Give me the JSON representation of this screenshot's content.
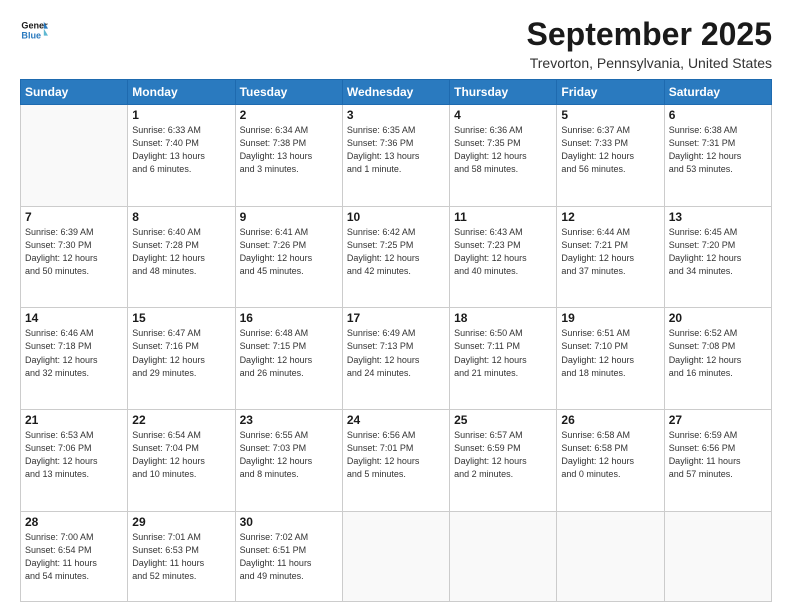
{
  "header": {
    "logo_general": "General",
    "logo_blue": "Blue",
    "month": "September 2025",
    "location": "Trevorton, Pennsylvania, United States"
  },
  "weekdays": [
    "Sunday",
    "Monday",
    "Tuesday",
    "Wednesday",
    "Thursday",
    "Friday",
    "Saturday"
  ],
  "weeks": [
    [
      {
        "day": "",
        "info": ""
      },
      {
        "day": "1",
        "info": "Sunrise: 6:33 AM\nSunset: 7:40 PM\nDaylight: 13 hours\nand 6 minutes."
      },
      {
        "day": "2",
        "info": "Sunrise: 6:34 AM\nSunset: 7:38 PM\nDaylight: 13 hours\nand 3 minutes."
      },
      {
        "day": "3",
        "info": "Sunrise: 6:35 AM\nSunset: 7:36 PM\nDaylight: 13 hours\nand 1 minute."
      },
      {
        "day": "4",
        "info": "Sunrise: 6:36 AM\nSunset: 7:35 PM\nDaylight: 12 hours\nand 58 minutes."
      },
      {
        "day": "5",
        "info": "Sunrise: 6:37 AM\nSunset: 7:33 PM\nDaylight: 12 hours\nand 56 minutes."
      },
      {
        "day": "6",
        "info": "Sunrise: 6:38 AM\nSunset: 7:31 PM\nDaylight: 12 hours\nand 53 minutes."
      }
    ],
    [
      {
        "day": "7",
        "info": "Sunrise: 6:39 AM\nSunset: 7:30 PM\nDaylight: 12 hours\nand 50 minutes."
      },
      {
        "day": "8",
        "info": "Sunrise: 6:40 AM\nSunset: 7:28 PM\nDaylight: 12 hours\nand 48 minutes."
      },
      {
        "day": "9",
        "info": "Sunrise: 6:41 AM\nSunset: 7:26 PM\nDaylight: 12 hours\nand 45 minutes."
      },
      {
        "day": "10",
        "info": "Sunrise: 6:42 AM\nSunset: 7:25 PM\nDaylight: 12 hours\nand 42 minutes."
      },
      {
        "day": "11",
        "info": "Sunrise: 6:43 AM\nSunset: 7:23 PM\nDaylight: 12 hours\nand 40 minutes."
      },
      {
        "day": "12",
        "info": "Sunrise: 6:44 AM\nSunset: 7:21 PM\nDaylight: 12 hours\nand 37 minutes."
      },
      {
        "day": "13",
        "info": "Sunrise: 6:45 AM\nSunset: 7:20 PM\nDaylight: 12 hours\nand 34 minutes."
      }
    ],
    [
      {
        "day": "14",
        "info": "Sunrise: 6:46 AM\nSunset: 7:18 PM\nDaylight: 12 hours\nand 32 minutes."
      },
      {
        "day": "15",
        "info": "Sunrise: 6:47 AM\nSunset: 7:16 PM\nDaylight: 12 hours\nand 29 minutes."
      },
      {
        "day": "16",
        "info": "Sunrise: 6:48 AM\nSunset: 7:15 PM\nDaylight: 12 hours\nand 26 minutes."
      },
      {
        "day": "17",
        "info": "Sunrise: 6:49 AM\nSunset: 7:13 PM\nDaylight: 12 hours\nand 24 minutes."
      },
      {
        "day": "18",
        "info": "Sunrise: 6:50 AM\nSunset: 7:11 PM\nDaylight: 12 hours\nand 21 minutes."
      },
      {
        "day": "19",
        "info": "Sunrise: 6:51 AM\nSunset: 7:10 PM\nDaylight: 12 hours\nand 18 minutes."
      },
      {
        "day": "20",
        "info": "Sunrise: 6:52 AM\nSunset: 7:08 PM\nDaylight: 12 hours\nand 16 minutes."
      }
    ],
    [
      {
        "day": "21",
        "info": "Sunrise: 6:53 AM\nSunset: 7:06 PM\nDaylight: 12 hours\nand 13 minutes."
      },
      {
        "day": "22",
        "info": "Sunrise: 6:54 AM\nSunset: 7:04 PM\nDaylight: 12 hours\nand 10 minutes."
      },
      {
        "day": "23",
        "info": "Sunrise: 6:55 AM\nSunset: 7:03 PM\nDaylight: 12 hours\nand 8 minutes."
      },
      {
        "day": "24",
        "info": "Sunrise: 6:56 AM\nSunset: 7:01 PM\nDaylight: 12 hours\nand 5 minutes."
      },
      {
        "day": "25",
        "info": "Sunrise: 6:57 AM\nSunset: 6:59 PM\nDaylight: 12 hours\nand 2 minutes."
      },
      {
        "day": "26",
        "info": "Sunrise: 6:58 AM\nSunset: 6:58 PM\nDaylight: 12 hours\nand 0 minutes."
      },
      {
        "day": "27",
        "info": "Sunrise: 6:59 AM\nSunset: 6:56 PM\nDaylight: 11 hours\nand 57 minutes."
      }
    ],
    [
      {
        "day": "28",
        "info": "Sunrise: 7:00 AM\nSunset: 6:54 PM\nDaylight: 11 hours\nand 54 minutes."
      },
      {
        "day": "29",
        "info": "Sunrise: 7:01 AM\nSunset: 6:53 PM\nDaylight: 11 hours\nand 52 minutes."
      },
      {
        "day": "30",
        "info": "Sunrise: 7:02 AM\nSunset: 6:51 PM\nDaylight: 11 hours\nand 49 minutes."
      },
      {
        "day": "",
        "info": ""
      },
      {
        "day": "",
        "info": ""
      },
      {
        "day": "",
        "info": ""
      },
      {
        "day": "",
        "info": ""
      }
    ]
  ]
}
